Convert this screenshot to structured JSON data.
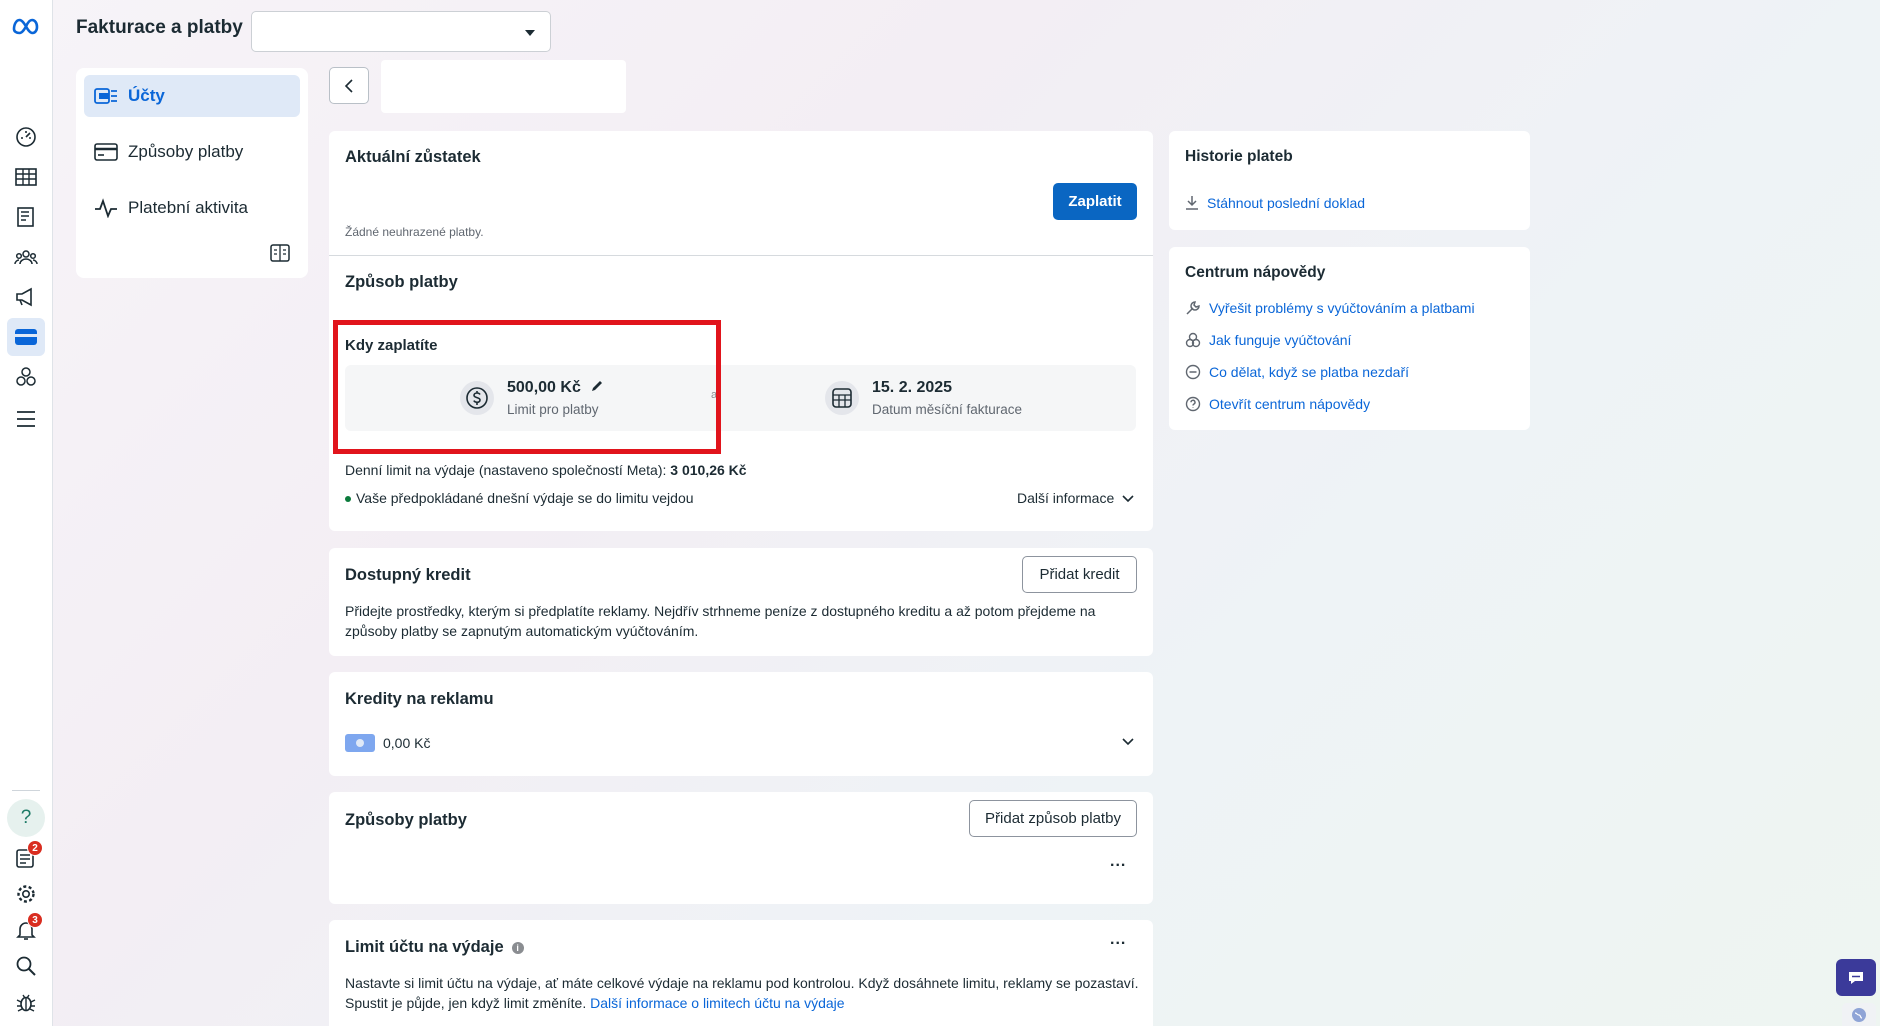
{
  "header": {
    "title": "Fakturace a platby",
    "account_select_value": ""
  },
  "rail": {
    "icons": [
      "meta-logo-icon",
      "dashboard-icon",
      "table-icon",
      "catalog-icon",
      "audience-icon",
      "megaphone-icon",
      "billing-card-icon",
      "business-assets-icon",
      "menu-icon",
      "help-icon",
      "notifications-list-icon",
      "settings-icon",
      "bell-icon",
      "search-icon",
      "bug-icon"
    ],
    "badge_news": "2",
    "badge_bell": "3"
  },
  "subnav": {
    "items": [
      {
        "label": "Účty",
        "icon": "accounts-icon",
        "active": true
      },
      {
        "label": "Způsoby platby",
        "icon": "card-icon",
        "active": false
      },
      {
        "label": "Platební aktivita",
        "icon": "activity-icon",
        "active": false
      }
    ]
  },
  "balance": {
    "title": "Aktuální zůstatek",
    "pay_button": "Zaplatit",
    "no_payments": "Žádné neuhrazené platby."
  },
  "payment_method": {
    "title": "Způsob platby"
  },
  "when_pay": {
    "title": "Kdy zaplatíte",
    "limit_value": "500,00 Kč",
    "limit_label": "Limit pro platby",
    "or_text": "a",
    "date_value": "15. 2. 2025",
    "date_label": "Datum měsíční fakturace"
  },
  "daily_limit": {
    "text": "Denní limit na výdaje (nastaveno společností Meta):",
    "amount": "3 010,26 Kč",
    "status": "Vaše předpokládané dnešní výdaje se do limitu vejdou",
    "more_info": "Další informace"
  },
  "credit": {
    "title": "Dostupný kredit",
    "button": "Přidat kredit",
    "description_line1": "Přidejte prostředky, kterým si předplatíte reklamy. Nejdřív strhneme peníze z dostupného kreditu a až potom přejdeme na",
    "description_line2": "způsoby platby se zapnutým automatickým vyúčtováním."
  },
  "ad_credits": {
    "title": "Kredity na reklamu",
    "amount": "0,00 Kč"
  },
  "payment_methods": {
    "title": "Způsoby platby",
    "button": "Přidat způsob platby",
    "more": "..."
  },
  "spend_limit": {
    "title": "Limit účtu na výdaje",
    "more": "...",
    "description_line1": "Nastavte si limit účtu na výdaje, ať máte celkové výdaje na reklamu pod kontrolou. Když dosáhnete limitu, reklamy se pozastaví.",
    "description_line2": "Spustit je půjde, jen když limit změníte.",
    "link": "Další informace o limitech účtu na výdaje"
  },
  "history": {
    "title": "Historie plateb",
    "download_link": "Stáhnout poslední doklad"
  },
  "help": {
    "title": "Centrum nápovědy",
    "links": [
      {
        "label": "Vyřešit problémy s vyúčtováním a platbami",
        "icon": "wrench-icon"
      },
      {
        "label": "Jak funguje vyúčtování",
        "icon": "billing-help-icon"
      },
      {
        "label": "Co dělat, když se platba nezdaří",
        "icon": "minus-circle-icon"
      },
      {
        "label": "Otevřít centrum nápovědy",
        "icon": "question-circle-icon"
      }
    ]
  },
  "colors": {
    "primary": "#0a66c2",
    "link": "#0a66d8",
    "highlight_box": "#e1141c",
    "active_nav_bg": "#dfe9f7",
    "badge": "#d92d20",
    "status_dot": "#0b7a3b"
  }
}
